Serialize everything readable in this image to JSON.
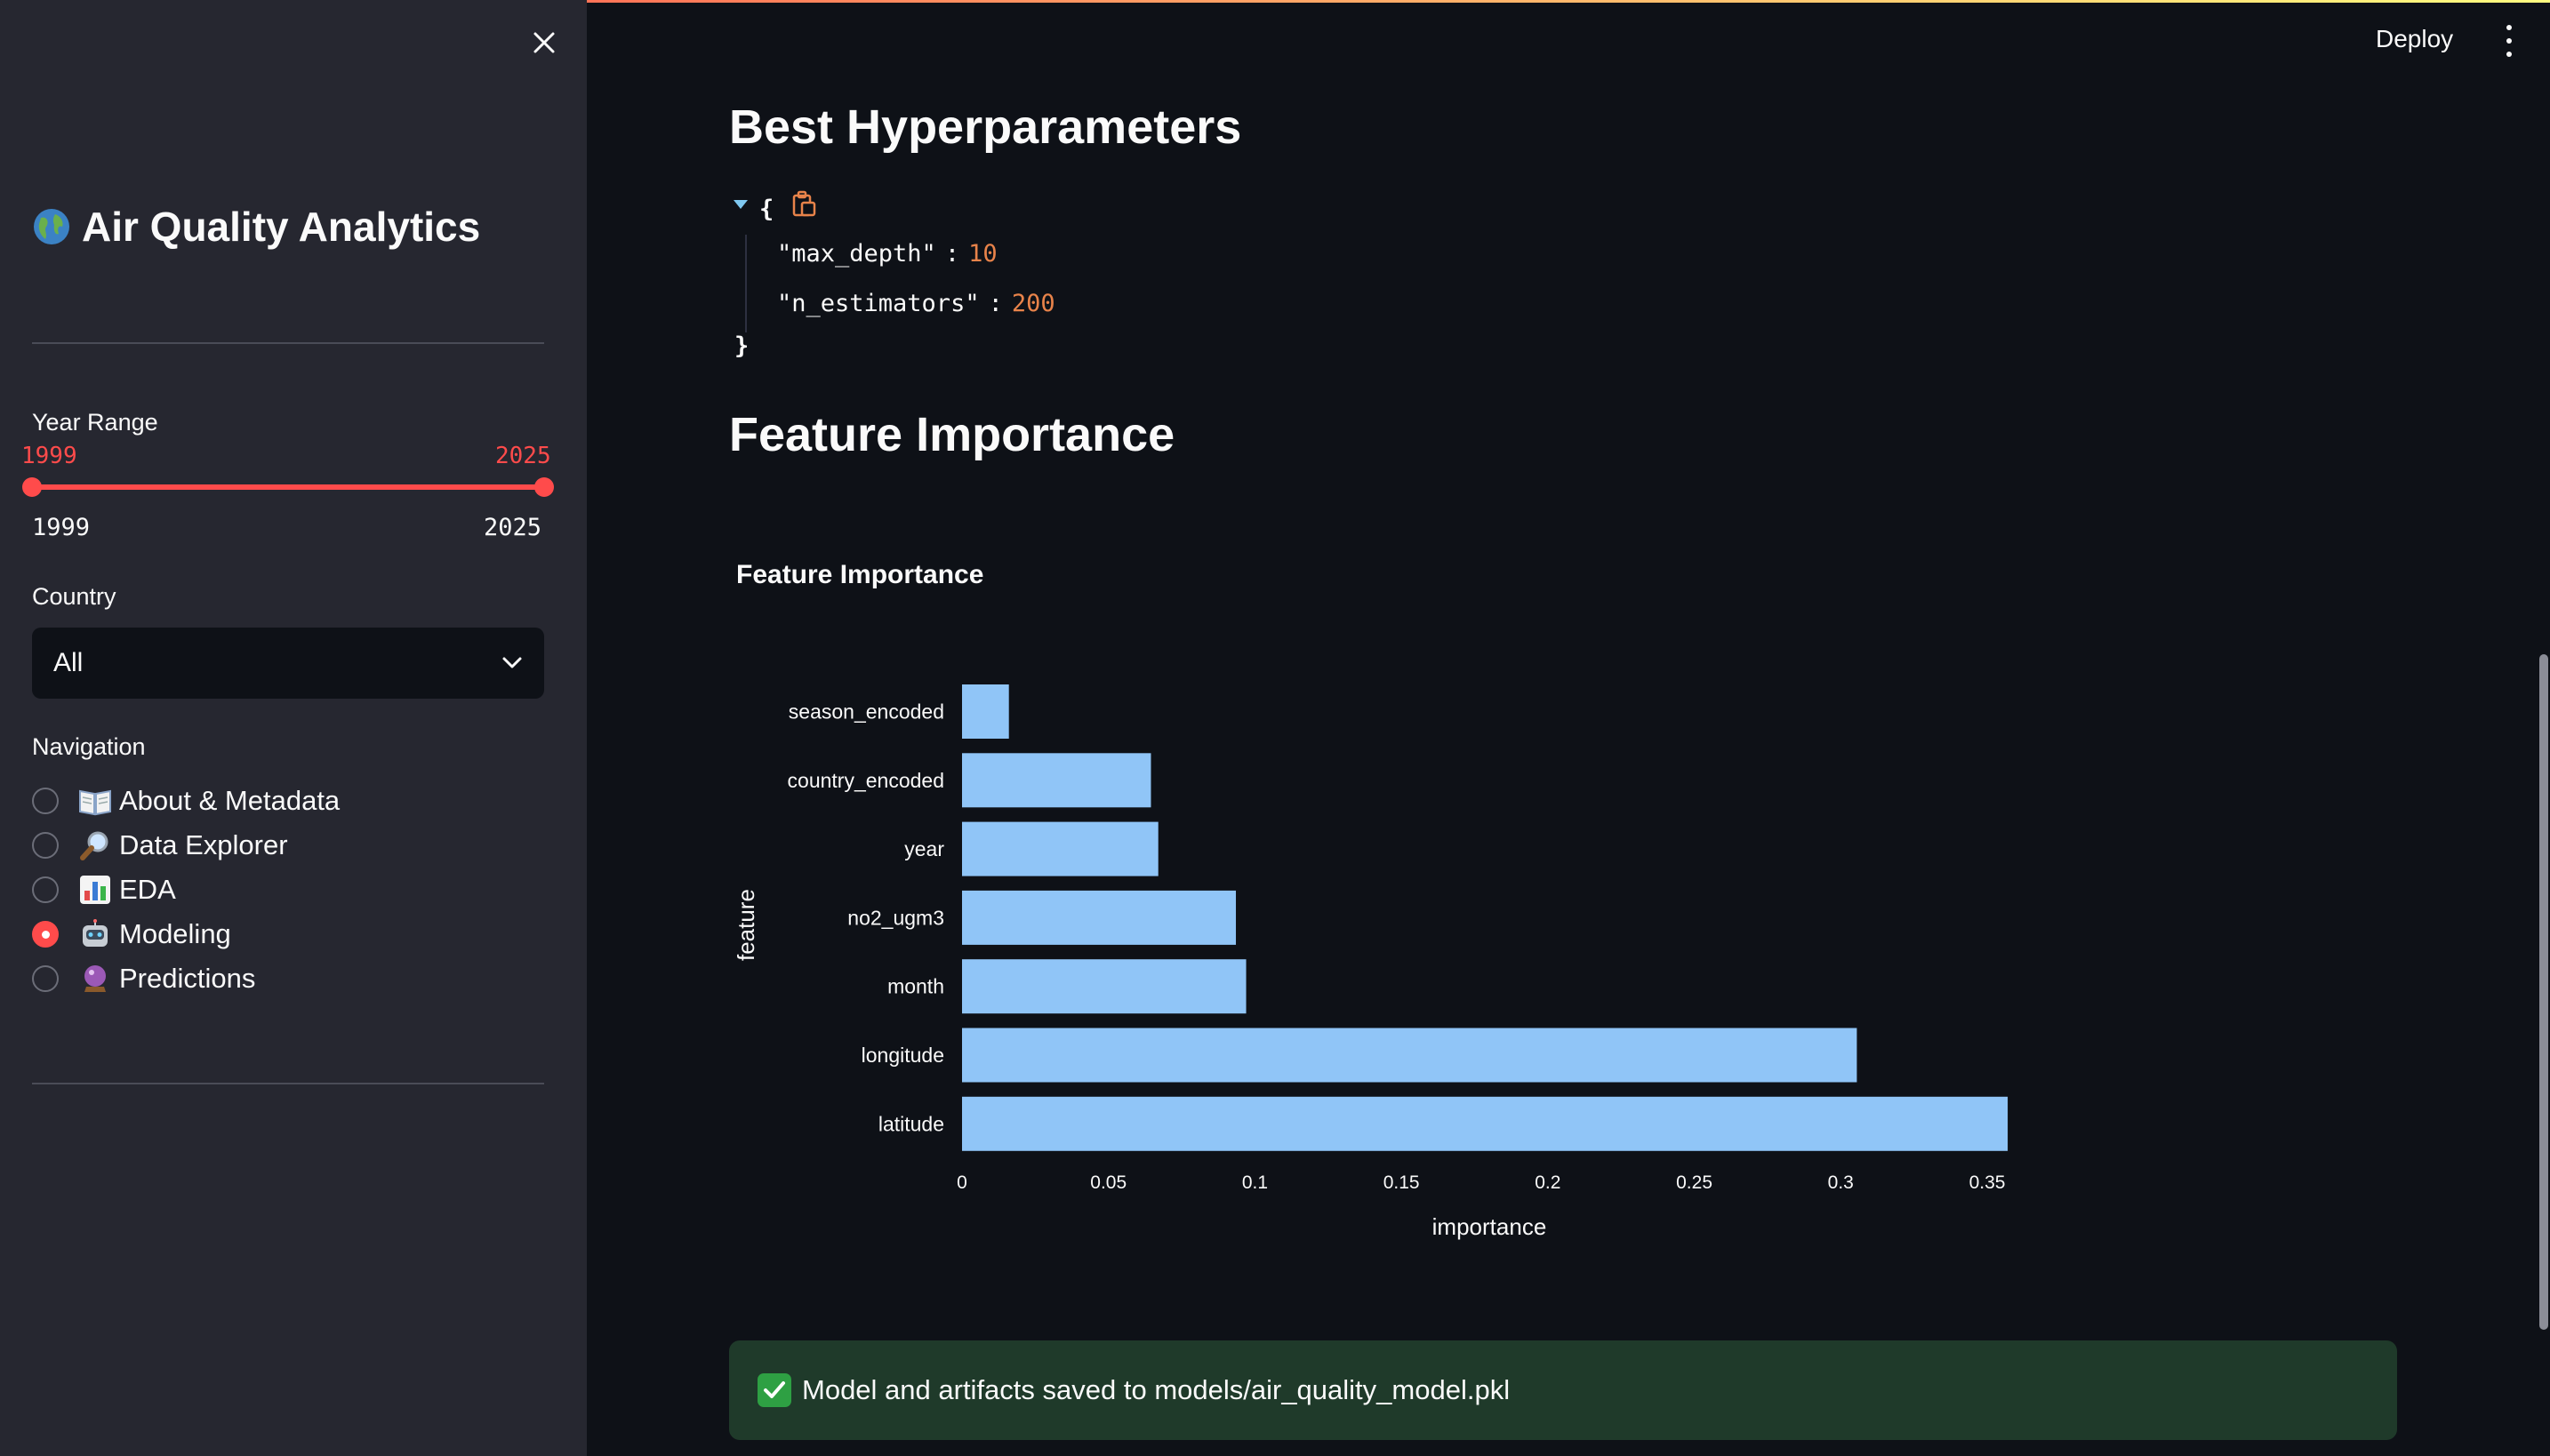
{
  "sidebar": {
    "title": "Air Quality Analytics",
    "title_icon": "globe-icon",
    "year_range": {
      "label": "Year Range",
      "selected_min": "1999",
      "selected_max": "2025",
      "min": "1999",
      "max": "2025",
      "color": "#ff4b4b"
    },
    "country": {
      "label": "Country",
      "value": "All"
    },
    "navigation": {
      "label": "Navigation",
      "items": [
        {
          "label": "About & Metadata",
          "icon": "book-icon",
          "selected": false
        },
        {
          "label": "Data Explorer",
          "icon": "magnifier-icon",
          "selected": false
        },
        {
          "label": "EDA",
          "icon": "bar-chart-icon",
          "selected": false
        },
        {
          "label": "Modeling",
          "icon": "robot-icon",
          "selected": true
        },
        {
          "label": "Predictions",
          "icon": "crystal-ball-icon",
          "selected": false
        }
      ]
    }
  },
  "header": {
    "deploy_label": "Deploy",
    "menu_icon": "more-vertical-icon"
  },
  "main": {
    "hyperparams_heading": "Best Hyperparameters",
    "hyperparams": {
      "open_brace": "{",
      "close_brace": "}",
      "rows": [
        {
          "key": "\"max_depth\"",
          "colon": ":",
          "value": "10"
        },
        {
          "key": "\"n_estimators\"",
          "colon": ":",
          "value": "200"
        }
      ]
    },
    "feature_heading": "Feature Importance",
    "chart_title": "Feature Importance",
    "success_message": "Model and artifacts saved to models/air_quality_model.pkl"
  },
  "colors": {
    "accent": "#ff4b4b",
    "bar": "#90c5f7",
    "json_number": "#e8834a",
    "success_bg": "#1f3a2a"
  },
  "chart_data": {
    "type": "bar",
    "orientation": "horizontal",
    "title": "Feature Importance",
    "xlabel": "importance",
    "ylabel": "feature",
    "categories": [
      "season_encoded",
      "country_encoded",
      "year",
      "no2_ugm3",
      "month",
      "longitude",
      "latitude"
    ],
    "values": [
      0.016,
      0.0645,
      0.067,
      0.0935,
      0.097,
      0.3055,
      0.357
    ],
    "xlim": [
      0,
      0.36
    ],
    "xticks": [
      "0",
      "0.05",
      "0.1",
      "0.15",
      "0.2",
      "0.25",
      "0.3",
      "0.35"
    ],
    "grid": false,
    "legend": "none"
  }
}
